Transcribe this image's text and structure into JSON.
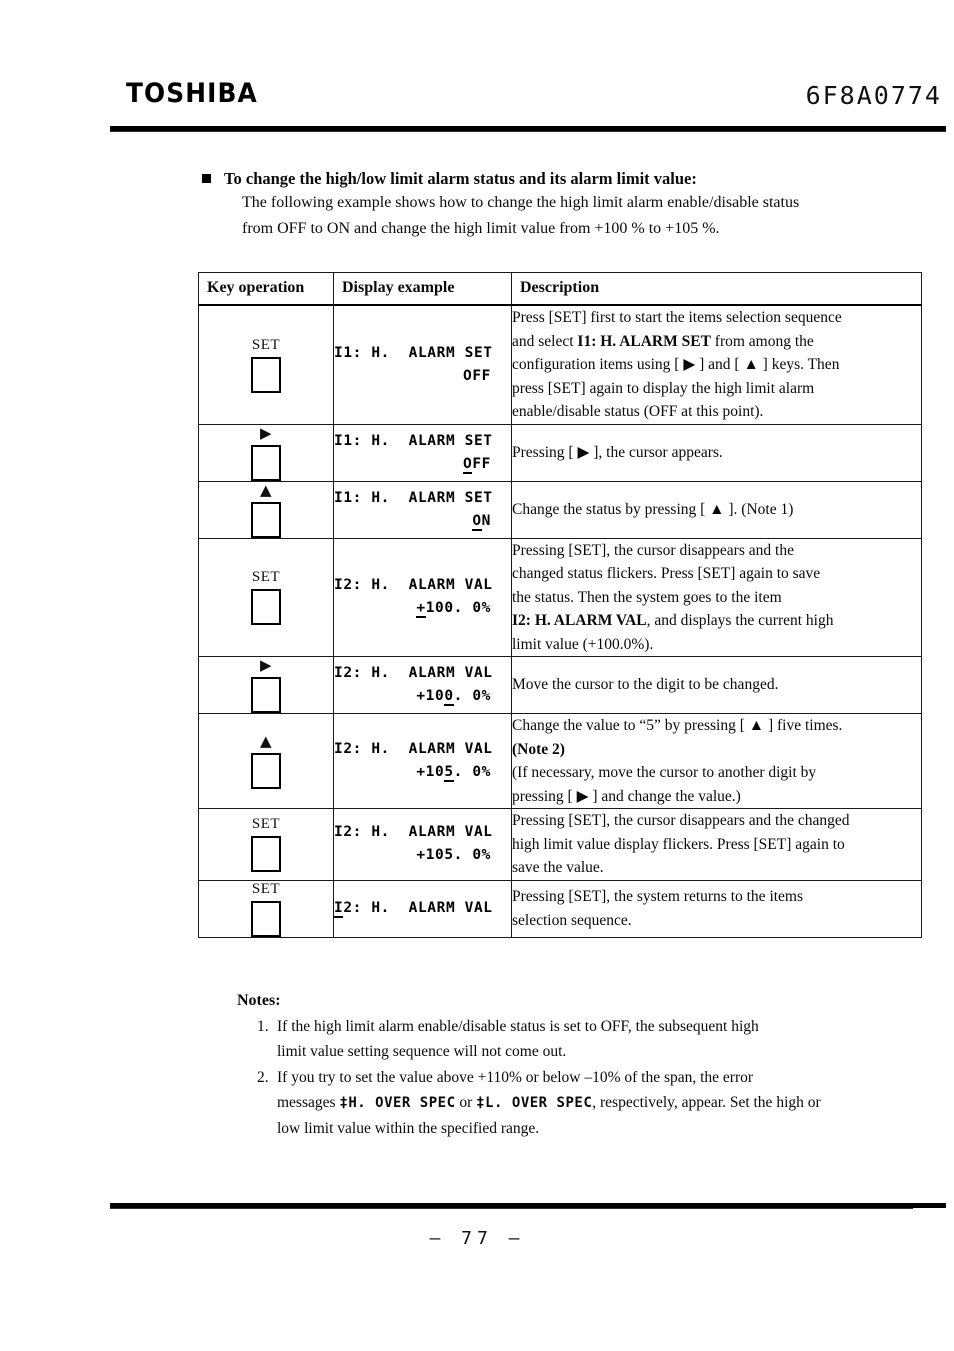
{
  "header": {
    "logo": "TOSHIBA",
    "doc_number": "6F8A0774"
  },
  "intro": {
    "heading": "To change the high/low limit alarm status and its alarm limit value:",
    "line1": "The following example shows how to change the high limit alarm enable/disable status",
    "line2": "from OFF to ON and change the high limit value from +100 % to +105 %."
  },
  "table": {
    "columns": [
      "Key operation",
      "Display example",
      "Description"
    ],
    "rows": [
      {
        "key_label": "SET",
        "key_icon": "square-button",
        "display_line1": "I1: H.  ALARM SET",
        "display_line2": "OFF",
        "cursor_on": "none",
        "desc_lines": [
          "Press [SET] first to start the items selection sequence",
          "and select I1: H. ALARM SET from among the",
          "configuration items using [ ▶ ] and [ ▲ ] keys. Then",
          "press [SET] again to display the high limit alarm",
          "enable/disable status (OFF at this point)."
        ],
        "desc_bold": "I1: H. ALARM SET"
      },
      {
        "key_label": "▶",
        "key_icon": "right-arrow-button",
        "display_line1": "I1: H.  ALARM SET",
        "display_line2": "OFF",
        "cursor_on": "first-char",
        "desc_lines": [
          "Pressing [ ▶ ], the cursor appears."
        ]
      },
      {
        "key_label": "▲",
        "key_icon": "up-arrow-button",
        "display_line1": "I1: H.  ALARM SET",
        "display_line2": "ON",
        "cursor_on": "first-char",
        "desc_lines": [
          "Change the status by pressing [ ▲ ]. (Note 1)"
        ]
      },
      {
        "key_label": "SET",
        "key_icon": "square-button",
        "display_line1": "I2: H.  ALARM VAL",
        "display_line2": "+100. 0%",
        "cursor_on": "first-char",
        "desc_lines": [
          "Pressing [SET], the cursor disappears and the",
          "changed status flickers. Press [SET] again to save",
          "the status. Then the system goes to the item",
          "I2: H. ALARM VAL, and displays the current high",
          "limit value (+100.0%)."
        ],
        "desc_bold": "I2: H. ALARM VAL"
      },
      {
        "key_label": "▶",
        "key_icon": "right-arrow-button",
        "display_line1": "I2: H.  ALARM VAL",
        "display_line2": "+100. 0%",
        "cursor_on": "digit-3",
        "desc_lines": [
          "Move the cursor to the digit to be changed."
        ]
      },
      {
        "key_label": "▲",
        "key_icon": "up-arrow-button",
        "display_line1": "I2: H.  ALARM VAL",
        "display_line2": "+105. 0%",
        "cursor_on": "digit-3",
        "desc_lines": [
          "Change the value to “5” by pressing [ ▲ ] five times.",
          "(Note 2)",
          "(If necessary, move the cursor to another digit by",
          "pressing [ ▶ ] and change the value.)"
        ],
        "desc_bold": "(Note 2)"
      },
      {
        "key_label": "SET",
        "key_icon": "square-button",
        "display_line1": "I2: H.  ALARM VAL",
        "display_line2": "+105. 0%",
        "cursor_on": "none",
        "desc_lines": [
          "Pressing [SET], the cursor disappears and the changed",
          "high limit value display flickers. Press [SET] again to",
          "save the value."
        ]
      },
      {
        "key_label": "SET",
        "key_icon": "square-button",
        "display_line1": "I2: H.  ALARM VAL",
        "display_line2": "",
        "cursor_on": "line1-first-char",
        "desc_lines": [
          "Pressing [SET], the system returns to the items",
          "selection sequence."
        ]
      }
    ]
  },
  "notes": {
    "title": "Notes:",
    "items": [
      {
        "number": "1.",
        "lines": [
          "If the high limit alarm enable/disable status is set to OFF, the subsequent high",
          "limit value setting sequence will not come out."
        ]
      },
      {
        "number": "2.",
        "lines": [
          "If you try to set the value above +110% or below –10% of the span, the error",
          "messages ‡H. OVER SPEC or ‡L. OVER SPEC, respectively, appear. Set the high or",
          "low limit value within the specified range."
        ],
        "error_message_high": "‡H.  OVER SPEC",
        "error_message_low": "‡L.  OVER SPEC"
      }
    ]
  },
  "footer": {
    "page_number": "–  77  –"
  }
}
